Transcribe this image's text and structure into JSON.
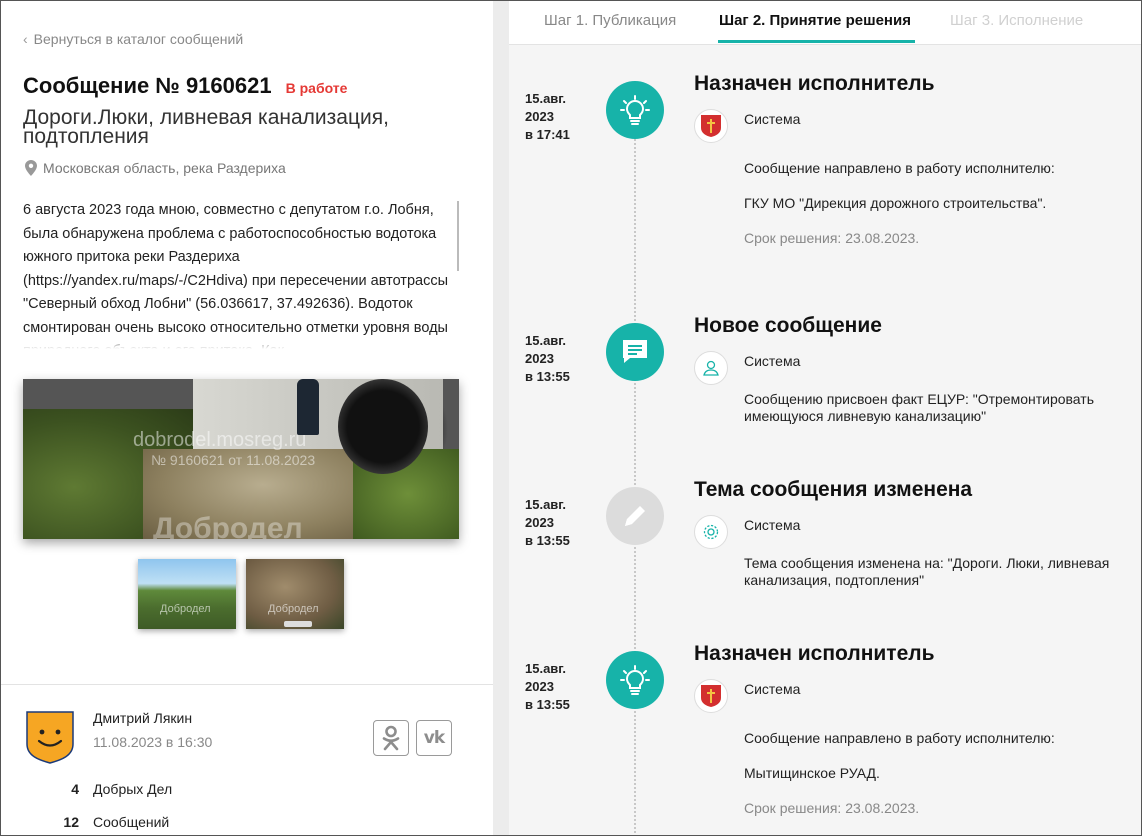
{
  "left": {
    "back_link": "Вернуться в каталог сообщений",
    "title": "Сообщение № 9160621",
    "status": "В работе",
    "status_color": "#e53935",
    "subtitle": "Дороги.Люки, ливневая канализация, подтопления",
    "location": "Московская область, река Раздериха",
    "description": "6 августа 2023 года мною, совместно с депутатом г.о. Лобня, была обнаружена проблема с работоспособностью водотока южного притока реки Раздериха (https://yandex.ru/maps/-/C2Hdiva) при пересечении автотрассы \"Северный обход Лобни\" (56.036617, 37.492636). Водоток смонтирован очень высоко относительно отметки уровня воды природного объекта и его притока. Как",
    "photo_watermark_1": "dobrodel.mosreg.ru",
    "photo_watermark_2": "№ 9160621 от 11.08.2023",
    "photo_watermark_3": "Добродел",
    "thumb_watermark": "Добродел",
    "author": {
      "name": "Дмитрий Лякин",
      "date": "11.08.2023 в 16:30"
    },
    "stats": [
      {
        "num": "4",
        "label": "Добрых Дел"
      },
      {
        "num": "12",
        "label": "Сообщений"
      }
    ]
  },
  "tabs": [
    {
      "label": "Шаг 1. Публикация",
      "state": "inactive"
    },
    {
      "label": "Шаг 2. Принятие решения",
      "state": "active"
    },
    {
      "label": "Шаг 3. Исполнение",
      "state": "disabled"
    }
  ],
  "accent_color": "#17b3a9",
  "events": [
    {
      "date_day": "15.авг.",
      "date_year": "2023",
      "date_time": "в 17:41",
      "icon": "lightbulb-icon",
      "title": "Назначен исполнитель",
      "source_icon": "coat-of-arms-icon",
      "source": "Система",
      "text1": "Сообщение направлено в работу исполнителю:",
      "text2": "ГКУ МО \"Дирекция дорожного строительства\".",
      "deadline": "Срок решения: 23.08.2023."
    },
    {
      "date_day": "15.авг.",
      "date_year": "2023",
      "date_time": "в 13:55",
      "icon": "message-icon",
      "title": "Новое сообщение",
      "source_icon": "user-icon",
      "source": "Система",
      "text1": "Сообщению присвоен факт ЕЦУР: \"Отремонтировать имеющуюся ливневую канализацию\""
    },
    {
      "date_day": "15.авг.",
      "date_year": "2023",
      "date_time": "в 13:55",
      "icon": "pencil-icon",
      "title": "Тема сообщения изменена",
      "source_icon": "gear-icon",
      "source": "Система",
      "text1": "Тема сообщения изменена на: \"Дороги. Люки, ливневая канализация, подтопления\""
    },
    {
      "date_day": "15.авг.",
      "date_year": "2023",
      "date_time": "в 13:55",
      "icon": "lightbulb-icon",
      "title": "Назначен исполнитель",
      "source_icon": "coat-of-arms-icon",
      "source": "Система",
      "text1": "Сообщение направлено в работу исполнителю:",
      "text2": "Мытищинское РУАД.",
      "deadline": "Срок решения: 23.08.2023."
    }
  ]
}
